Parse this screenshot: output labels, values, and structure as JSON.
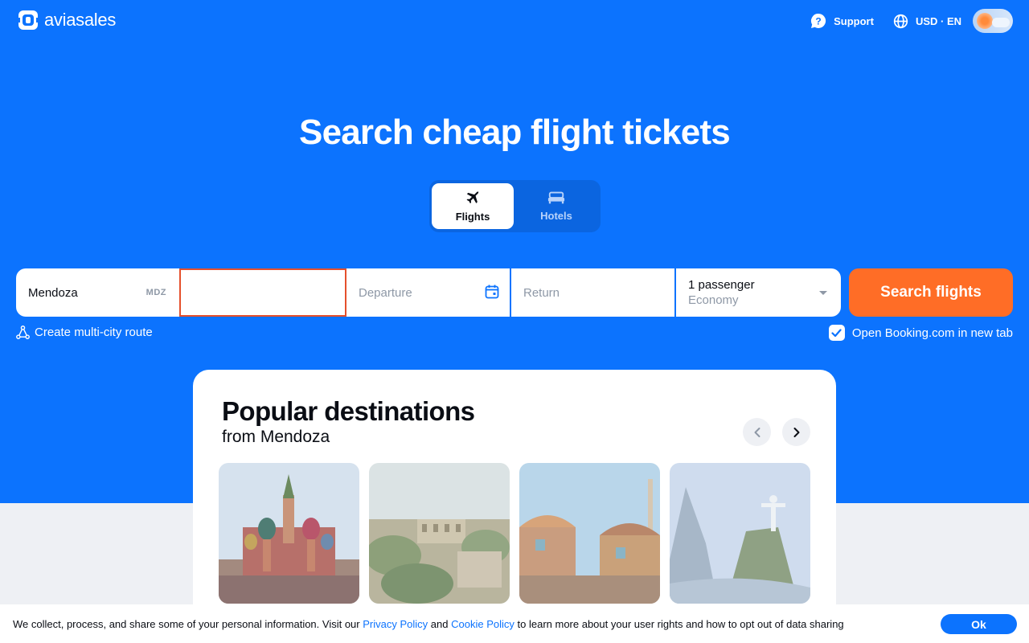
{
  "header": {
    "logo_text": "aviasales",
    "support_label": "Support",
    "locale_label": "USD · EN"
  },
  "hero": {
    "title": "Search cheap flight tickets"
  },
  "tabs": [
    {
      "label": "Flights",
      "active": true,
      "icon": "plane-icon"
    },
    {
      "label": "Hotels",
      "active": false,
      "icon": "bed-icon"
    }
  ],
  "search": {
    "origin_value": "Mendoza",
    "origin_code": "MDZ",
    "destination_value": "",
    "departure_placeholder": "Departure",
    "return_placeholder": "Return",
    "passengers_label": "1 passenger",
    "class_label": "Economy",
    "button_label": "Search flights",
    "multi_city_label": "Create multi-city route",
    "booking_label": "Open Booking.com in new tab",
    "booking_checked": true
  },
  "popular": {
    "title": "Popular destinations",
    "subtitle": "from Mendoza"
  },
  "cookie": {
    "text_before": "We collect, process, and share some of your personal information. Visit our",
    "privacy_link": "Privacy Policy",
    "text_and": "and",
    "cookie_link": "Cookie Policy",
    "text_after": "to learn more about your user rights and how to opt out of data sharing",
    "ok_label": "Ok"
  },
  "colors": {
    "brand_blue": "#0c73fe",
    "search_orange": "#ff6d26",
    "error_border": "#e5502c"
  }
}
